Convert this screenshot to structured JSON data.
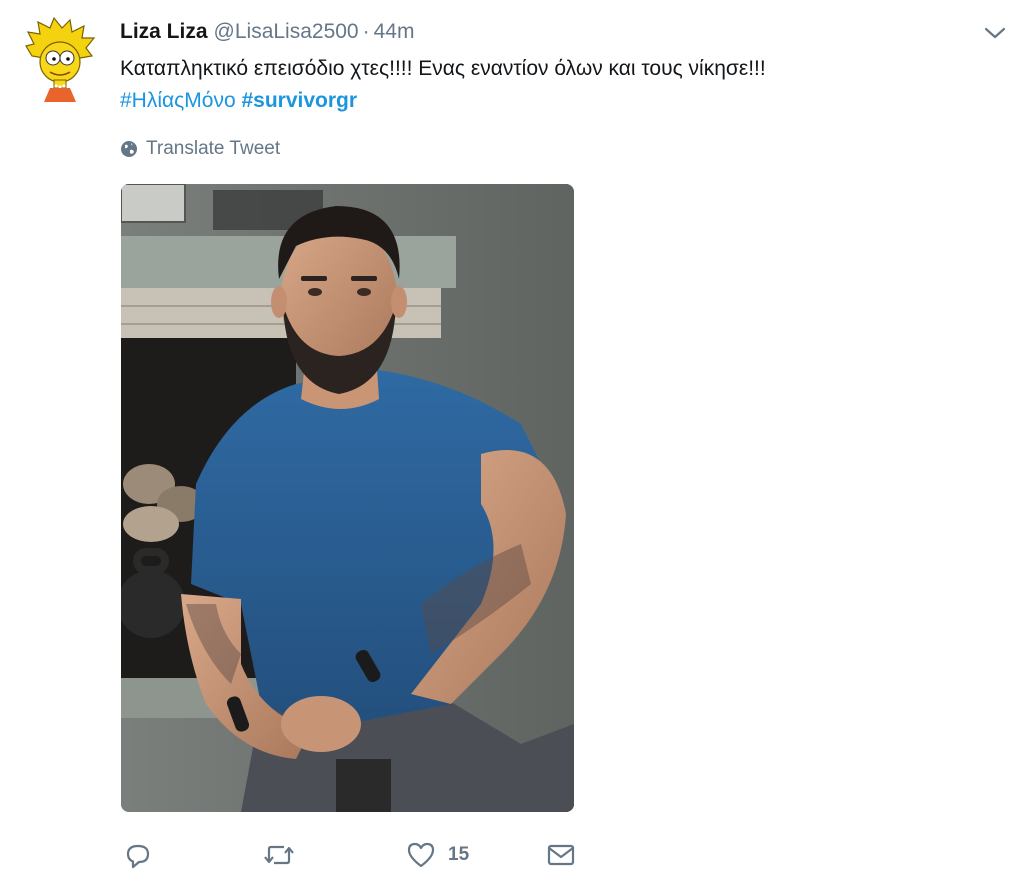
{
  "tweet": {
    "display_name": "Liza Liza",
    "handle": "@LisaLisa2500",
    "separator": "·",
    "time": "44m",
    "text": "Καταπληκτικό επεισόδιο χτες!!!! Ενας εναντίον όλων και τους νίκησε!!!",
    "hashtag_1": "#ΗλίαςΜόνο",
    "hashtag_2": "#survivorgr",
    "translate_label": "Translate Tweet",
    "like_count": "15"
  },
  "icons": {
    "avatar": "cartoon-girl-avatar",
    "caret": "chevron-down-icon",
    "translate": "globe-icon",
    "reply": "reply-icon",
    "retweet": "retweet-icon",
    "like": "heart-icon",
    "dm": "envelope-icon"
  },
  "colors": {
    "link": "#1b95e0",
    "secondary": "#657786",
    "text": "#14171a"
  }
}
